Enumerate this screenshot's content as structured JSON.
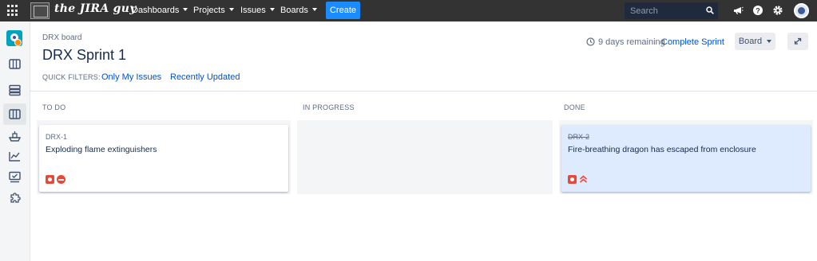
{
  "topbar": {
    "logo_text": "the JIRA guy",
    "nav": [
      {
        "label": "Dashboards"
      },
      {
        "label": "Projects"
      },
      {
        "label": "Issues"
      },
      {
        "label": "Boards"
      }
    ],
    "create_label": "Create",
    "search_placeholder": "Search",
    "icons": [
      "apps-grid-icon",
      "megaphone-icon",
      "help-icon",
      "settings-gear-icon",
      "user-avatar-icon"
    ]
  },
  "sidebar": {
    "icons": [
      "project-avatar-icon",
      "backlog-icon",
      "active-sprints-icon",
      "board-columns-icon",
      "releases-icon",
      "reports-icon",
      "issues-icon",
      "add-ons-icon"
    ],
    "active_index": 3
  },
  "header": {
    "breadcrumb": "DRX board",
    "title": "DRX Sprint 1",
    "remaining": "9 days remaining",
    "complete_sprint": "Complete Sprint",
    "board_button": "Board"
  },
  "quick_filters": {
    "label": "QUICK FILTERS:",
    "items": [
      "Only My Issues",
      "Recently Updated"
    ]
  },
  "columns": [
    {
      "title": "TO DO",
      "cards": [
        {
          "key": "DRX-1",
          "summary": "Exploding flame extinguishers",
          "type_icon": "bug-icon",
          "priority_icon": "blocker-priority-icon",
          "done": false
        }
      ]
    },
    {
      "title": "IN PROGRESS",
      "cards": []
    },
    {
      "title": "DONE",
      "cards": [
        {
          "key": "DRX-2",
          "summary": "Fire-breathing dragon has escaped from enclosure",
          "type_icon": "bug-icon",
          "priority_icon": "highest-priority-icon",
          "done": true
        }
      ]
    }
  ],
  "colors": {
    "topbar_bg": "#333333",
    "create_button": "#1a8cff",
    "link": "#0052cc",
    "done_card_bg": "#deebff",
    "bug_red": "#e5493a"
  }
}
